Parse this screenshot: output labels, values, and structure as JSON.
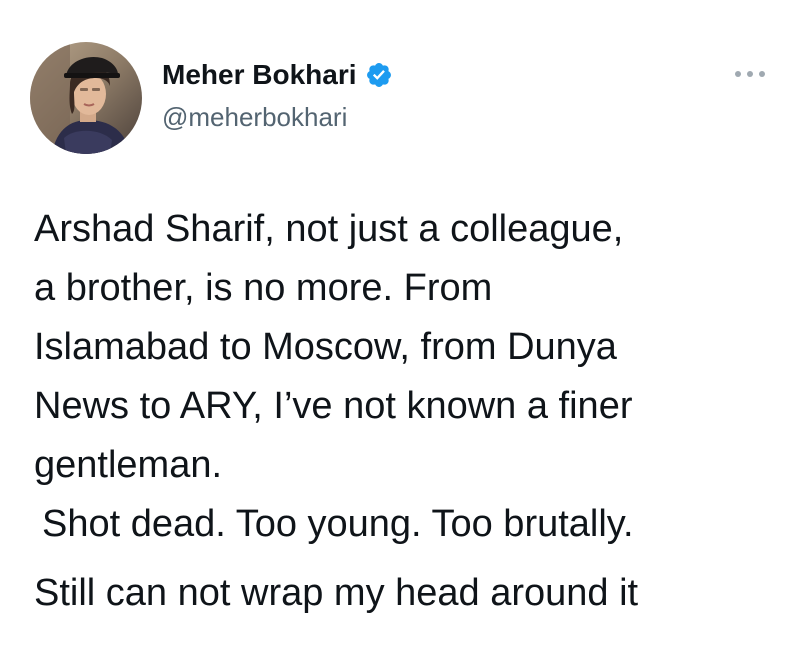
{
  "author": {
    "display_name": "Meher Bokhari",
    "handle": "@meherbokhari",
    "verified": true,
    "verified_icon": "verified-badge-icon",
    "verified_color": "#1d9bf0",
    "avatar_icon": "profile-photo-avatar"
  },
  "menu": {
    "icon": "more-options-icon"
  },
  "tweet": {
    "lines": [
      "Arshad Sharif, not just a colleague,",
      "a brother, is no more. From",
      "Islamabad to Moscow, from Dunya",
      "News to ARY, I’ve not known a finer",
      "gentleman.",
      "Shot dead. Too young. Too brutally.",
      "Still can not wrap my head around it"
    ]
  },
  "colors": {
    "text": "#0f1419",
    "secondary_text": "#536471",
    "background": "#ffffff"
  }
}
